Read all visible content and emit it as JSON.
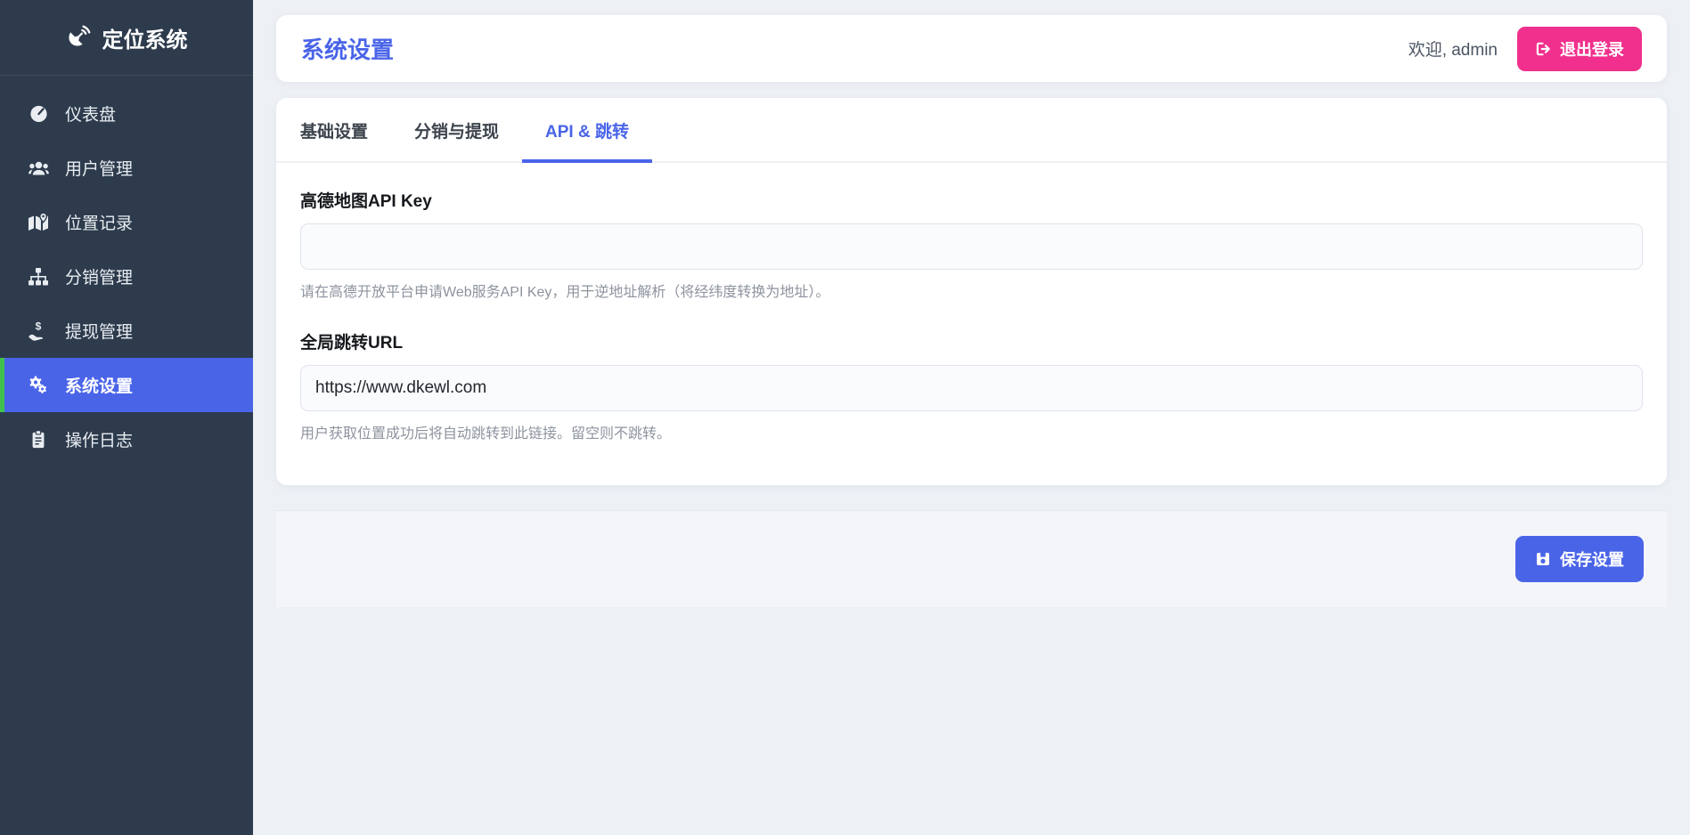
{
  "app": {
    "name": "定位系统"
  },
  "colors": {
    "primary_blue": "#4a64e8",
    "logout_pink": "#f0308c",
    "active_item_green_border": "#3fc24d",
    "sidebar_bg": "#2d3b4d"
  },
  "sidebar": {
    "logo_text": "定位系统",
    "items": [
      {
        "label": "仪表盘",
        "icon": "gauge-icon",
        "active": false
      },
      {
        "label": "用户管理",
        "icon": "users-icon",
        "active": false
      },
      {
        "label": "位置记录",
        "icon": "map-marker-icon",
        "active": false
      },
      {
        "label": "分销管理",
        "icon": "sitemap-icon",
        "active": false
      },
      {
        "label": "提现管理",
        "icon": "hand-dollar-icon",
        "active": false
      },
      {
        "label": "系统设置",
        "icon": "cogs-icon",
        "active": true
      },
      {
        "label": "操作日志",
        "icon": "clipboard-icon",
        "active": false
      }
    ]
  },
  "header": {
    "title": "系统设置",
    "welcome": "欢迎, admin",
    "logout_label": "退出登录"
  },
  "tabs": [
    {
      "label": "基础设置",
      "active": false
    },
    {
      "label": "分销与提现",
      "active": false
    },
    {
      "label": "API & 跳转",
      "active": true
    }
  ],
  "form": {
    "fields": [
      {
        "label": "高德地图API Key",
        "value": "",
        "help": "请在高德开放平台申请Web服务API Key，用于逆地址解析（将经纬度转换为地址）。"
      },
      {
        "label": "全局跳转URL",
        "value": "https://www.dkewl.com",
        "help": "用户获取位置成功后将自动跳转到此链接。留空则不跳转。"
      }
    ]
  },
  "footer": {
    "save_label": "保存设置"
  }
}
